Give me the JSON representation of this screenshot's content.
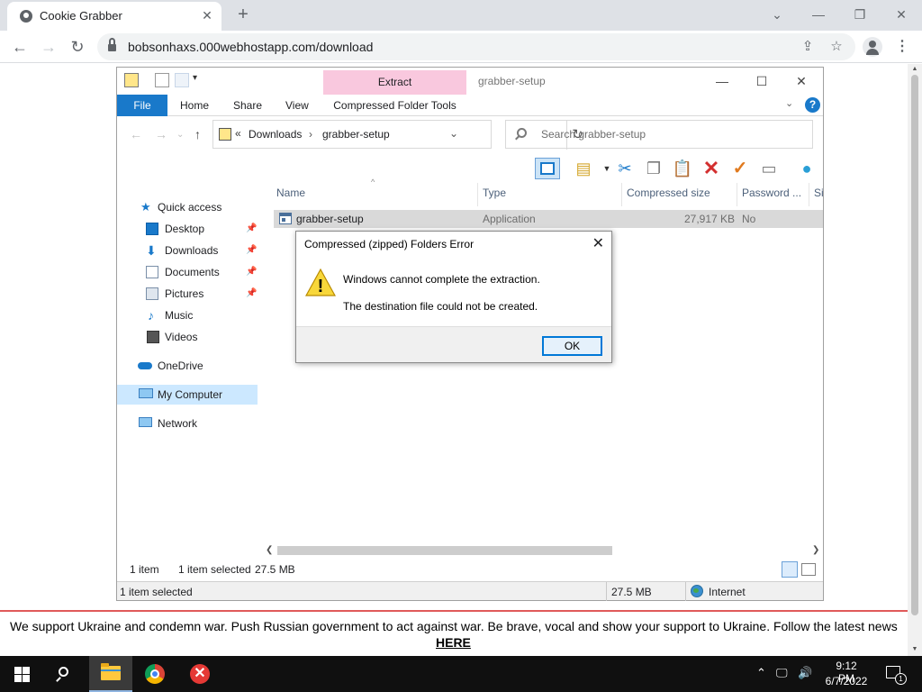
{
  "browser": {
    "tab_title": "Cookie Grabber",
    "tab_close": "✕",
    "new_tab": "+",
    "url": "bobsonhaxs.000webhostapp.com/download",
    "window_controls": {
      "minimize_chevron": "⌄",
      "minimize": "—",
      "restore": "❐",
      "close": "✕"
    },
    "nav": {
      "back": "←",
      "forward": "→",
      "reload": "↻"
    },
    "menu": "⋮"
  },
  "explorer": {
    "title": "grabber-setup",
    "contextual_tab": "Extract",
    "ribbon_tabs": {
      "file": "File",
      "home": "Home",
      "share": "Share",
      "view": "View",
      "tools": "Compressed Folder Tools"
    },
    "help": "?",
    "breadcrumb": [
      "Downloads",
      "grabber-setup"
    ],
    "search_placeholder": "Search grabber-setup",
    "nav_pane": {
      "quick_access": "Quick access",
      "desktop": "Desktop",
      "downloads": "Downloads",
      "documents": "Documents",
      "pictures": "Pictures",
      "music": "Music",
      "videos": "Videos",
      "onedrive": "OneDrive",
      "my_computer": "My Computer",
      "network": "Network"
    },
    "columns": {
      "name": "Name",
      "type": "Type",
      "compressed_size": "Compressed size",
      "password": "Password ...",
      "size": "Si"
    },
    "file": {
      "name": "grabber-setup",
      "type": "Application",
      "compressed_size": "27,917 KB",
      "password": "No"
    },
    "status": {
      "item_count": "1 item",
      "selected": "1 item selected",
      "selected_size": "27.5 MB"
    },
    "status_bar": {
      "selected": "1 item selected",
      "size": "27.5 MB",
      "zone": "Internet"
    }
  },
  "dialog": {
    "title": "Compressed (zipped) Folders Error",
    "message1": "Windows cannot complete the extraction.",
    "message2": "The destination file could not be created.",
    "ok": "OK",
    "warning_mark": "!"
  },
  "banner": {
    "text": "We support Ukraine and condemn war. Push Russian government to act against war. Be brave, vocal and show your support to Ukraine. Follow the latest news",
    "link": "HERE"
  },
  "taskbar": {
    "time": "9:12 PM",
    "date": "6/7/2022",
    "notifications": "1",
    "pinned_icons": [
      "windows-start-icon",
      "search-icon",
      "file-explorer-icon",
      "chrome-icon",
      "red-x-app-icon"
    ],
    "tray_icons": [
      "chevron-up-icon",
      "network-icon",
      "volume-icon"
    ]
  },
  "colors": {
    "ribbon_file": "#1979ca",
    "extract_tab": "#f9c8de",
    "banner_border": "#e05a5a",
    "dialog_ok_border": "#0078d7",
    "taskbar": "#101010"
  }
}
